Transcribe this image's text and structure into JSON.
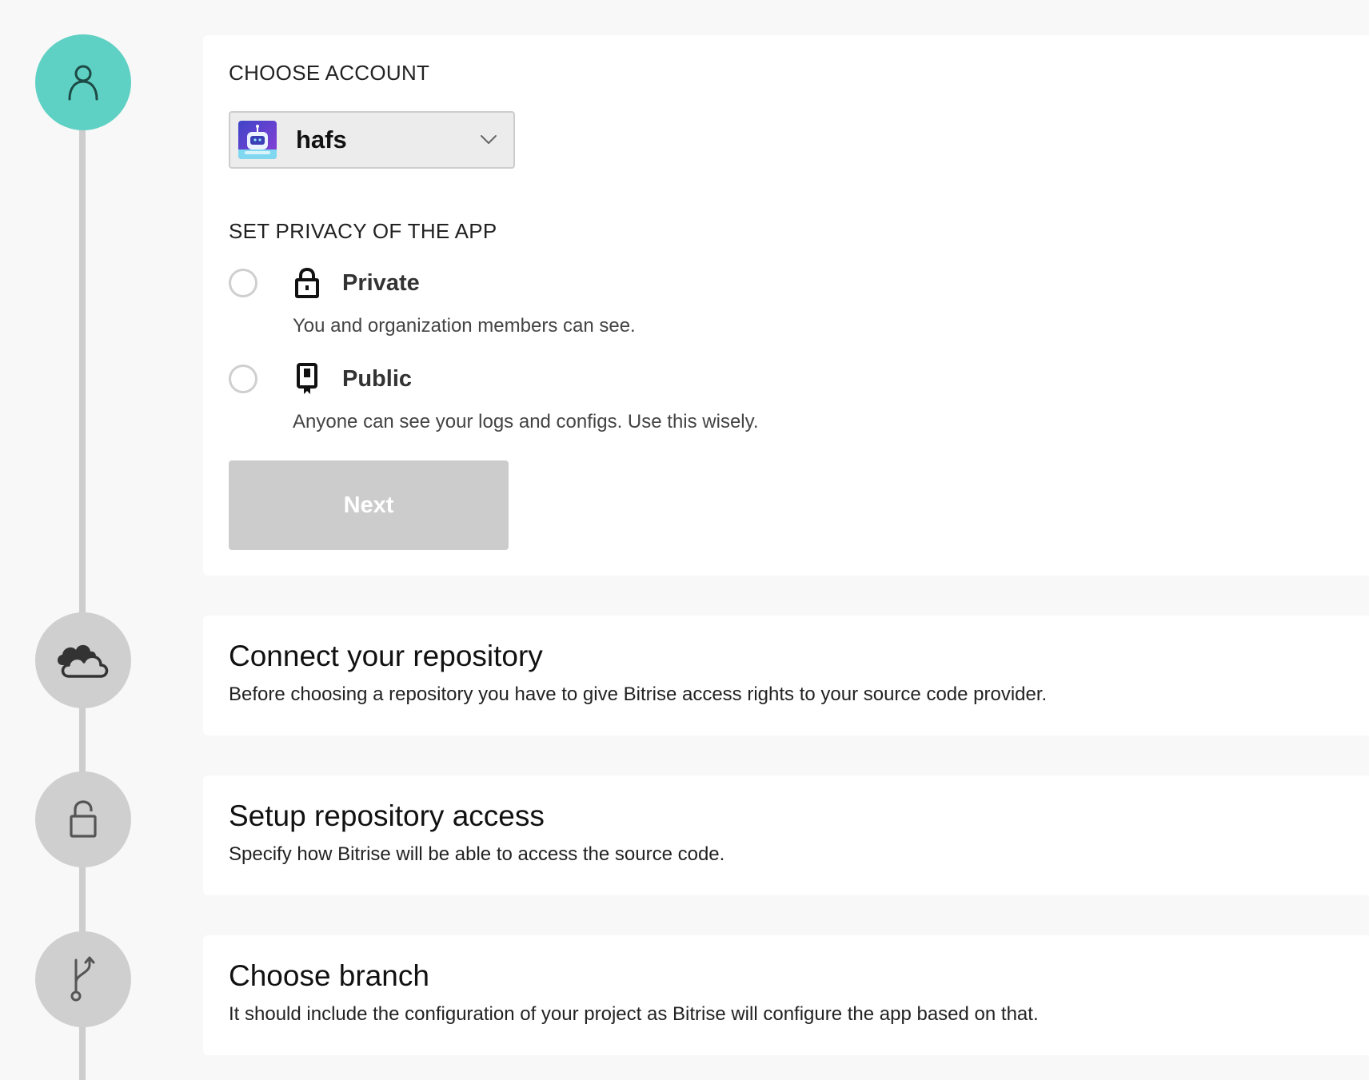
{
  "colors": {
    "active_step": "#5fd1c4",
    "inactive_step": "#cfcfcf",
    "button_disabled": "#cccccc",
    "page_background": "#f8f8f8"
  },
  "steps": [
    {
      "icon": "user-icon",
      "state": "active"
    },
    {
      "icon": "cloud-icon",
      "state": "inactive"
    },
    {
      "icon": "lock-open-icon",
      "state": "inactive"
    },
    {
      "icon": "git-branch-icon",
      "state": "inactive"
    }
  ],
  "account": {
    "label": "CHOOSE ACCOUNT",
    "selected": "hafs",
    "avatar_icon": "robot-avatar-icon",
    "dropdown_icon": "chevron-down-icon"
  },
  "privacy": {
    "label": "SET PRIVACY OF THE APP",
    "options": [
      {
        "icon": "lock-icon",
        "title": "Private",
        "description": "You and organization members can see.",
        "selected": false
      },
      {
        "icon": "public-badge-icon",
        "title": "Public",
        "description": "Anyone can see your logs and configs. Use this wisely.",
        "selected": false
      }
    ]
  },
  "next_button": {
    "label": "Next",
    "disabled": true
  },
  "sections": [
    {
      "title": "Connect your repository",
      "description": "Before choosing a repository you have to give Bitrise access rights to your source code provider."
    },
    {
      "title": "Setup repository access",
      "description": "Specify how Bitrise will be able to access the source code."
    },
    {
      "title": "Choose branch",
      "description": "It should include the configuration of your project as Bitrise will configure the app based on that."
    }
  ]
}
